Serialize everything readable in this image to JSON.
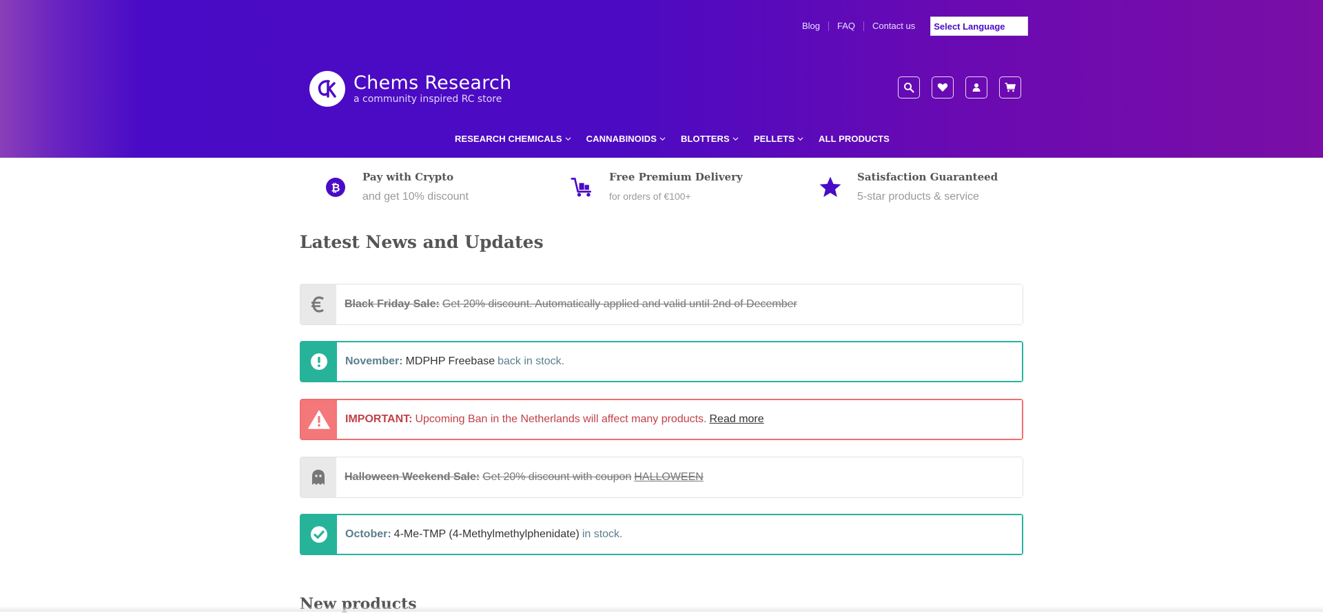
{
  "header": {
    "top_links": [
      "Blog",
      "FAQ",
      "Contact us"
    ],
    "language_select": "Select Language",
    "site_title": "Chems Research",
    "tagline": "a community inspired RC store",
    "icons": [
      "search-icon",
      "heart-icon",
      "user-icon",
      "cart-icon"
    ],
    "nav": [
      {
        "label": "RESEARCH CHEMICALS",
        "dropdown": true
      },
      {
        "label": "CANNABINOIDS",
        "dropdown": true
      },
      {
        "label": "BLOTTERS",
        "dropdown": true
      },
      {
        "label": "PELLETS",
        "dropdown": true
      },
      {
        "label": "ALL PRODUCTS",
        "dropdown": false
      }
    ]
  },
  "features": [
    {
      "icon": "bitcoin-icon",
      "title": "Pay with Crypto",
      "subtitle": "and get 10% discount"
    },
    {
      "icon": "delivery-cart-icon",
      "title": "Free Premium Delivery",
      "subtitle": "for orders of €100+"
    },
    {
      "icon": "star-icon",
      "title": "Satisfaction Guaranteed",
      "subtitle": "5-star products & service"
    }
  ],
  "news": {
    "title": "Latest News and Updates",
    "items": [
      {
        "style": "grey",
        "icon": "euro-icon",
        "label": "Black Friday Sale:",
        "text": "Get 20% discount. Automatically applied and valid until 2nd of December"
      },
      {
        "style": "teal",
        "icon": "exclamation-icon",
        "label": "November:",
        "highlight": "MDPHP Freebase",
        "text": "back in stock."
      },
      {
        "style": "red",
        "icon": "warning-icon",
        "label": "IMPORTANT:",
        "text": "Upcoming Ban in the Netherlands will affect many products.",
        "link": "Read more"
      },
      {
        "style": "grey",
        "icon": "ghost-icon",
        "label": "Halloween Weekend Sale:",
        "text": "Get 20% discount with coupon",
        "link": "HALLOWEEN"
      },
      {
        "style": "teal",
        "icon": "check-icon",
        "label": "October:",
        "highlight": "4-Me-TMP (4-Methylmethylphenidate)",
        "text": "in stock."
      }
    ]
  },
  "new_products_title": "New products",
  "colors": {
    "brand": "#4a0bc6",
    "teal": "#26b39a",
    "red": "#ef6e70"
  }
}
